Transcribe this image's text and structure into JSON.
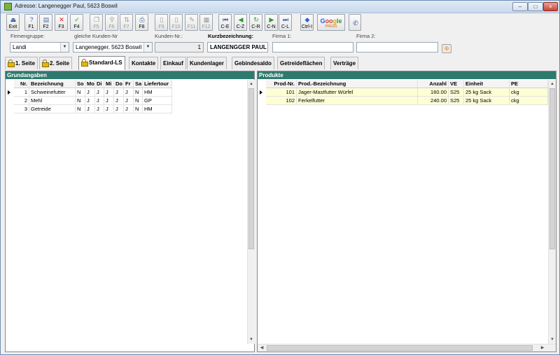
{
  "window": {
    "title": "Adresse: Langenegger Paul, 5623 Boswil",
    "min_label": "–",
    "max_label": "□",
    "close_label": "×"
  },
  "toolbar": {
    "buttons": [
      {
        "label": "Exit",
        "icon": "exit-icon",
        "glyph": "⏏",
        "color": "#2a4f9e"
      },
      {
        "label": "F1",
        "icon": "help-icon",
        "glyph": "?",
        "color": "#2a62d8"
      },
      {
        "label": "F2",
        "icon": "new-document-icon",
        "glyph": "▤",
        "color": "#4a6fb0"
      },
      {
        "label": "F3",
        "icon": "delete-icon",
        "glyph": "✕",
        "color": "#d02020"
      },
      {
        "label": "F4",
        "icon": "checkmark-icon",
        "glyph": "✓",
        "color": "#2f9a2f"
      },
      {
        "label": "F5",
        "icon": "copy-icon",
        "glyph": "❐",
        "color": "#999999"
      },
      {
        "label": "F6",
        "icon": "search-icon",
        "glyph": "⚲",
        "color": "#999999"
      },
      {
        "label": "F7",
        "icon": "sort-icon",
        "glyph": "⇅",
        "color": "#999999"
      },
      {
        "label": "F8",
        "icon": "print-icon",
        "glyph": "⎙",
        "color": "#3d6bb0"
      },
      {
        "label": "F9",
        "icon": "page-icon",
        "glyph": "▯",
        "color": "#999999"
      },
      {
        "label": "F10",
        "icon": "page-icon",
        "glyph": "▯",
        "color": "#999999"
      },
      {
        "label": "F11",
        "icon": "edit-icon",
        "glyph": "✎",
        "color": "#999999"
      },
      {
        "label": "F12",
        "icon": "calculator-icon",
        "glyph": "▦",
        "color": "#999999"
      },
      {
        "label": "C-E",
        "icon": "first-record-icon",
        "glyph": "⏮",
        "color": "#2a4f9e"
      },
      {
        "label": "C-Z",
        "icon": "previous-record-icon",
        "glyph": "◀",
        "color": "#2f9a2f"
      },
      {
        "label": "C-R",
        "icon": "refresh-icon",
        "glyph": "↻",
        "color": "#2f9a2f"
      },
      {
        "label": "C-N",
        "icon": "next-record-icon",
        "glyph": "▶",
        "color": "#2f9a2f"
      },
      {
        "label": "C-L",
        "icon": "last-record-icon",
        "glyph": "⏭",
        "color": "#2a4f9e"
      },
      {
        "label": "Ctrl-I",
        "icon": "info-icon",
        "glyph": "◆",
        "color": "#2a62d8"
      },
      {
        "label": "",
        "icon": "phone-icon",
        "glyph": "✆",
        "color": "#2a4f9e"
      }
    ],
    "google": {
      "g1": "G",
      "g2": "oo",
      "g3": "g",
      "g4": "le",
      "sub": "PRESS"
    }
  },
  "header": {
    "firmengruppe_label": "Firmengruppe:",
    "firmengruppe_value": "Landi",
    "kunden_nr_same_label": "gleiche Kunden-Nr",
    "kunden_nr_same_value": "Langenegger, 5623 Boswil",
    "kunden_nr_label": "Kunden-Nr.:",
    "kunden_nr_value": "1",
    "kurzbezeichnung_label": "Kurzbezeichnung:",
    "kurzbezeichnung_value": "LANGENGGER PAUL",
    "firma1_label": "Firma 1:",
    "firma1_value": "",
    "firma2_label": "Firma 2:",
    "firma2_value": "",
    "dropdown_glyph": "▼",
    "action_glyph": "◎"
  },
  "tabs": [
    {
      "label": "1. Seite",
      "lock": true
    },
    {
      "label": "2. Seite",
      "lock": true
    },
    {
      "label": "Standard-LS",
      "lock": true,
      "active": true
    },
    {
      "label": "Kontakte"
    },
    {
      "label": "Einkauf"
    },
    {
      "label": "Kundenlager"
    },
    {
      "label": "Gebindesaldo"
    },
    {
      "label": "Getreideflächen"
    },
    {
      "label": "Verträge"
    }
  ],
  "left_panel": {
    "title": "Grundangaben",
    "columns": [
      "Nr.",
      "Bezeichnung",
      "So",
      "Mo",
      "Di",
      "Mi",
      "Do",
      "Fr",
      "Sa",
      "Liefertour"
    ],
    "rows": [
      [
        "1",
        "Schweinefutter",
        "N",
        "J",
        "J",
        "J",
        "J",
        "J",
        "N",
        "HM"
      ],
      [
        "2",
        "Mehl",
        "N",
        "J",
        "J",
        "J",
        "J",
        "J",
        "N",
        "GP"
      ],
      [
        "3",
        "Getreide",
        "N",
        "J",
        "J",
        "J",
        "J",
        "J",
        "N",
        "HM"
      ]
    ]
  },
  "right_panel": {
    "title": "Produkte",
    "columns": [
      "Prod-Nr.",
      "Prod.-Bezeichnung",
      "Anzahl",
      "VE",
      "Einheit",
      "PE"
    ],
    "rows": [
      [
        "101",
        "Jager-Mastfutter Würfel",
        "160.00",
        "S25",
        "25 kg Sack",
        "ckg"
      ],
      [
        "102",
        "Ferkelfutter",
        "240.00",
        "S25",
        "25 kg Sack",
        "ckg"
      ]
    ]
  },
  "scroll": {
    "up": "▲",
    "down": "▼",
    "left": "◀",
    "right": "▶"
  }
}
